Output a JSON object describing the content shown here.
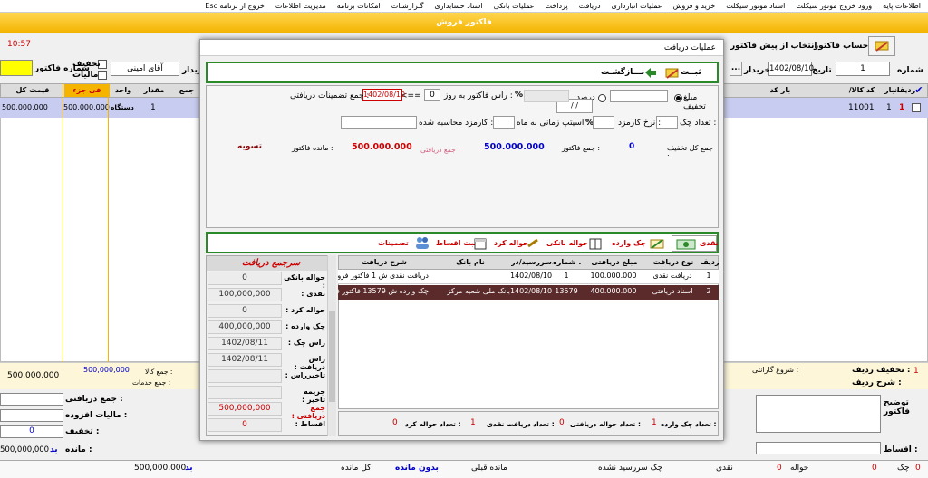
{
  "menu": [
    "اطلاعات پایه",
    "ورود خروج موتور سیکلت",
    "اسناد موتور سیکلت",
    "خرید و فروش",
    "عملیات انبارداری",
    "دریافت",
    "پرداخت",
    "عملیات بانکی",
    "اسناد حسابداری",
    "گـزارشـات",
    "امکانات برنامه",
    "مدیریت اطلاعات",
    "خروج از برنامه Esc"
  ],
  "window_title": "فاکتور فروش",
  "time": "10:57",
  "header": {
    "invoice_account": "حساب فاکتور",
    "select_from_prefactor": "انتخاب از پیش فاکتور",
    "number_label": "شماره",
    "number_value": "1",
    "date_label": "تاریخ",
    "date_value": "1402/08/10",
    "buyer_label": "خریدار",
    "buyer_value": "آقای امینی",
    "buyer_label2": "خریدار",
    "discount_label": "تخفیف",
    "tax_label": "مالیات",
    "invoice_no_label": "شماره فاکتور",
    "ellipsis": "..."
  },
  "grid": {
    "headers": [
      "ردیف",
      "انبار",
      "کد کالا/خدمات",
      "بار کد",
      "مقدار جزء",
      "واحد",
      "فی جزء",
      "جمع کل",
      "قیمت کل"
    ],
    "row": {
      "row": "1",
      "store": "1",
      "code": "11001",
      "qty": "1",
      "unit": "دستگاه",
      "unit_price": "500,000,000",
      "total": "500,000,000"
    }
  },
  "footer": {
    "row_discount": "تخفیف ردیف :",
    "row_desc": "شرح ردیف :",
    "warranty_start": "شروع گارانتی :",
    "goods_total_label": "جمع کالا :",
    "goods_total": "500,000,000",
    "services_total_label": "جمع خدمات :",
    "left_total": "500,000,000",
    "zero_a": "0",
    "zero_b": "0",
    "one": "1",
    "invoice_desc": "توضیح فاکتور",
    "installments": "اقساط :",
    "received_total_label": "جمع دریافتی :",
    "vat_label": "مالیات افزوده :",
    "discount_label": "تخفیف :",
    "discount_value": "0",
    "remaining_label": "مانده :",
    "remaining_value": "500,000,000",
    "bad": "بد"
  },
  "status": {
    "check": "چک",
    "check_val": "0",
    "draft": "حواله",
    "draft_val": "0",
    "cash": "نقدی",
    "check_due": "چک سررسید نشده",
    "prev_remaining": "مانده قبلی",
    "no_remaining": "بدون مانده",
    "total_remaining": "کل مانده",
    "bad": "بد",
    "amount": "500,000,000"
  },
  "dialog": {
    "title": "عملیات دریافت",
    "save_btn": "ثبــت",
    "back_btn": "بـــازگشـت",
    "discount_amount": "مبلغ تخفیف",
    "percent": "درصد",
    "pct_sign": "%",
    "slash": "/ /",
    "due_label": "راس فاکتور به روز :",
    "due_days": "0",
    "arrow": "<==",
    "due_date": "1402/08/10",
    "guarantee_total": "جمع تضمینات دریافتی :",
    "check_count": "تعداد چک :",
    "fee_rate": "نرخ کارمزد :",
    "time_step": "اسیتپ زمانی به ماه :",
    "fee_calc": "کارمزد محاسبه شده :",
    "total_discount": "جمع کل تخفیف :",
    "total_discount_val": "0",
    "invoice_total": "جمع فاکتور :",
    "invoice_total_val": "500.000.000",
    "received_total": "جمع دریافتی :",
    "received_total_val": "500.000.000",
    "invoice_remaining": "مانده فاکتور :",
    "settle": "تسویه",
    "tabs": [
      "نقدی",
      "چک وارده",
      "حواله بانکی",
      "حواله کرد",
      "ثبت اقساط",
      "تضمینات"
    ],
    "table_headers": [
      "ردیف",
      "نوع دریافت",
      "مبلغ دریافتی",
      "شماره ...",
      "سررسید/در...",
      "نام بانک",
      "شرح دریافت"
    ],
    "rows": [
      {
        "row": "1",
        "type": "دریافت نقدی",
        "amount": "100.000.000",
        "num": "1",
        "due": "1402/08/10",
        "bank": "",
        "desc": "دریافت نقدی ش 1 فاکتور فروش ش"
      },
      {
        "row": "2",
        "type": "اسناد دریافتی",
        "amount": "400.000.000",
        "num": "13579",
        "due": "1402/08/10",
        "bank": "بانک ملی شعبه مرکز",
        "desc": "چک وارده ش 13579 فاکتور فروش"
      }
    ],
    "summary_title": "سرجمع دریافت",
    "summary": [
      {
        "label": "حواله بانکی :",
        "value": "0"
      },
      {
        "label": "نقدی :",
        "value": "100,000,000"
      },
      {
        "label": "حواله کرد :",
        "value": "0"
      },
      {
        "label": "چک وارده :",
        "value": "400,000,000"
      },
      {
        "label": "راس چک :",
        "value": "1402/08/11"
      },
      {
        "label": "راس دریافت :",
        "value": "1402/08/11"
      },
      {
        "label": "تاخیرراس :",
        "value": ""
      },
      {
        "label": "جریمه تاخیر :",
        "value": ""
      },
      {
        "label": "جمع دریافتی :",
        "value": "500,000,000"
      },
      {
        "label": "اقساط :",
        "value": "0"
      }
    ],
    "count_check": "تعداد چک وارده :",
    "count_check_val": "1",
    "count_draft": "تعداد حواله دریافتی :",
    "count_draft_val": "0",
    "count_cash": "تعداد دریافت نقدی :",
    "count_cash_val": "1",
    "count_transfer": "تعداد حواله کرد :",
    "count_transfer_val": "0"
  }
}
